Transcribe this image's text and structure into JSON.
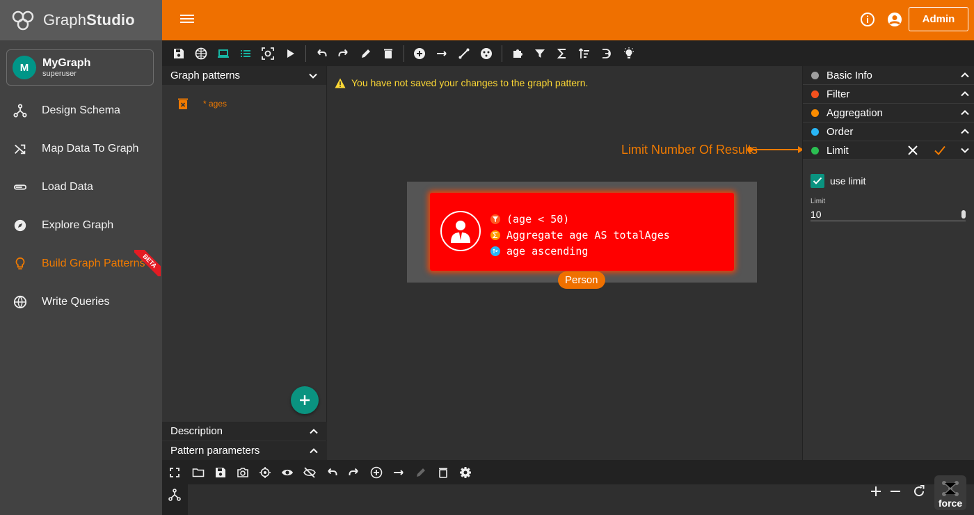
{
  "brand": {
    "name_regular": "Graph",
    "name_bold": "Studio"
  },
  "graph": {
    "initial": "M",
    "name": "MyGraph",
    "user": "superuser"
  },
  "nav": [
    {
      "label": "Design Schema"
    },
    {
      "label": "Map Data To Graph"
    },
    {
      "label": "Load Data"
    },
    {
      "label": "Explore Graph"
    },
    {
      "label": "Build Graph Patterns",
      "badge": "BETA",
      "active": true
    },
    {
      "label": "Write Queries"
    }
  ],
  "topbar": {
    "admin_label": "Admin"
  },
  "patterns_panel": {
    "title": "Graph patterns",
    "items": [
      {
        "name": "* ages"
      }
    ],
    "description_title": "Description",
    "parameters_title": "Pattern parameters"
  },
  "canvas": {
    "warning": "You have not saved your changes to the graph pattern.",
    "node": {
      "label": "Person",
      "filter": "(age < 50)",
      "aggregate": "Aggregate age AS totalAges",
      "order": "age ascending"
    },
    "callout": "Limit Number Of Results"
  },
  "right_panel": {
    "sections": [
      {
        "title": "Basic Info",
        "color": "#9e9e9e"
      },
      {
        "title": "Filter",
        "color": "#f4511e"
      },
      {
        "title": "Aggregation",
        "color": "#fb8c00"
      },
      {
        "title": "Order",
        "color": "#29b6f6"
      },
      {
        "title": "Limit",
        "color": "#2bbf52"
      }
    ],
    "use_limit_label": "use limit",
    "limit_field_label": "Limit",
    "limit_value": "10"
  },
  "bottom": {
    "layout_label": "force"
  },
  "colors": {
    "accent": "#ef7000",
    "teal": "#009688",
    "node_red": "#ff0000"
  }
}
